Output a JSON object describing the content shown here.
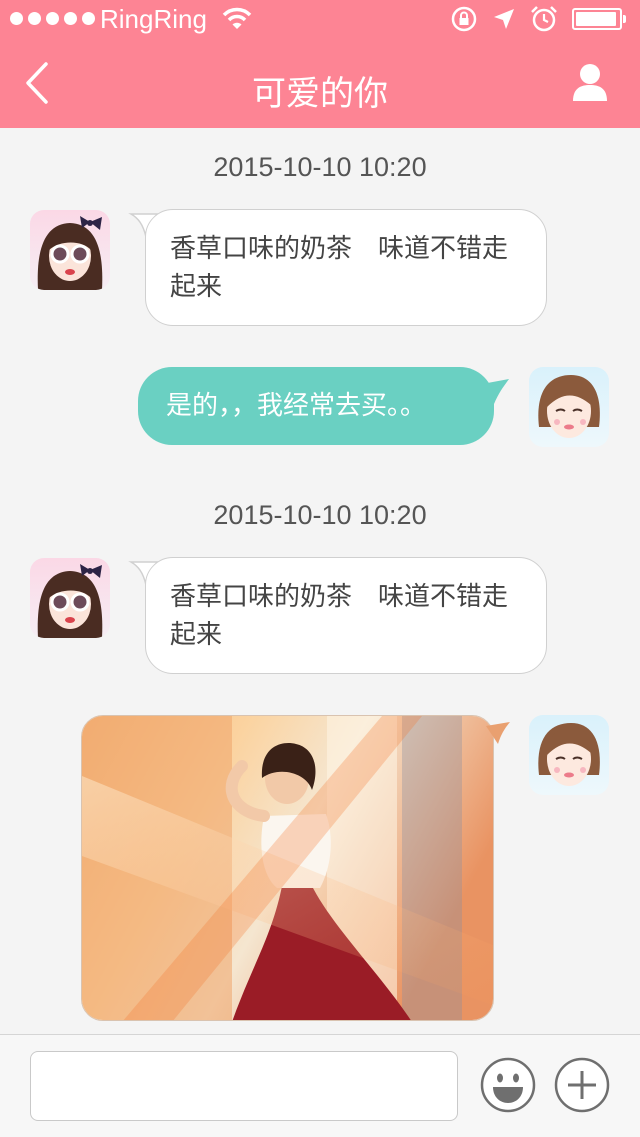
{
  "status_bar": {
    "carrier": "RingRing",
    "icons": [
      "wifi-icon",
      "rotation-lock-icon",
      "location-arrow-icon",
      "alarm-icon",
      "battery-icon"
    ]
  },
  "nav": {
    "title": "可爱的你",
    "back_icon": "chevron-left-icon",
    "profile_icon": "user-icon"
  },
  "messages": [
    {
      "type": "timestamp",
      "text": "2015-10-10    10:20"
    },
    {
      "type": "incoming",
      "text": "香草口味的奶茶　味道不错走起来"
    },
    {
      "type": "outgoing",
      "text": "是的，，我经常去买。。"
    },
    {
      "type": "timestamp",
      "text": "2015-10-10    10:20"
    },
    {
      "type": "incoming",
      "text": "香草口味的奶茶　味道不错走起来"
    },
    {
      "type": "outgoing-image"
    }
  ],
  "input_bar": {
    "placeholder": "",
    "emoji_icon": "smiley-icon",
    "add_icon": "plus-icon"
  },
  "colors": {
    "header": "#fd8494",
    "outgoing_bubble": "#6ad0c2",
    "background": "#f4f4f4"
  }
}
